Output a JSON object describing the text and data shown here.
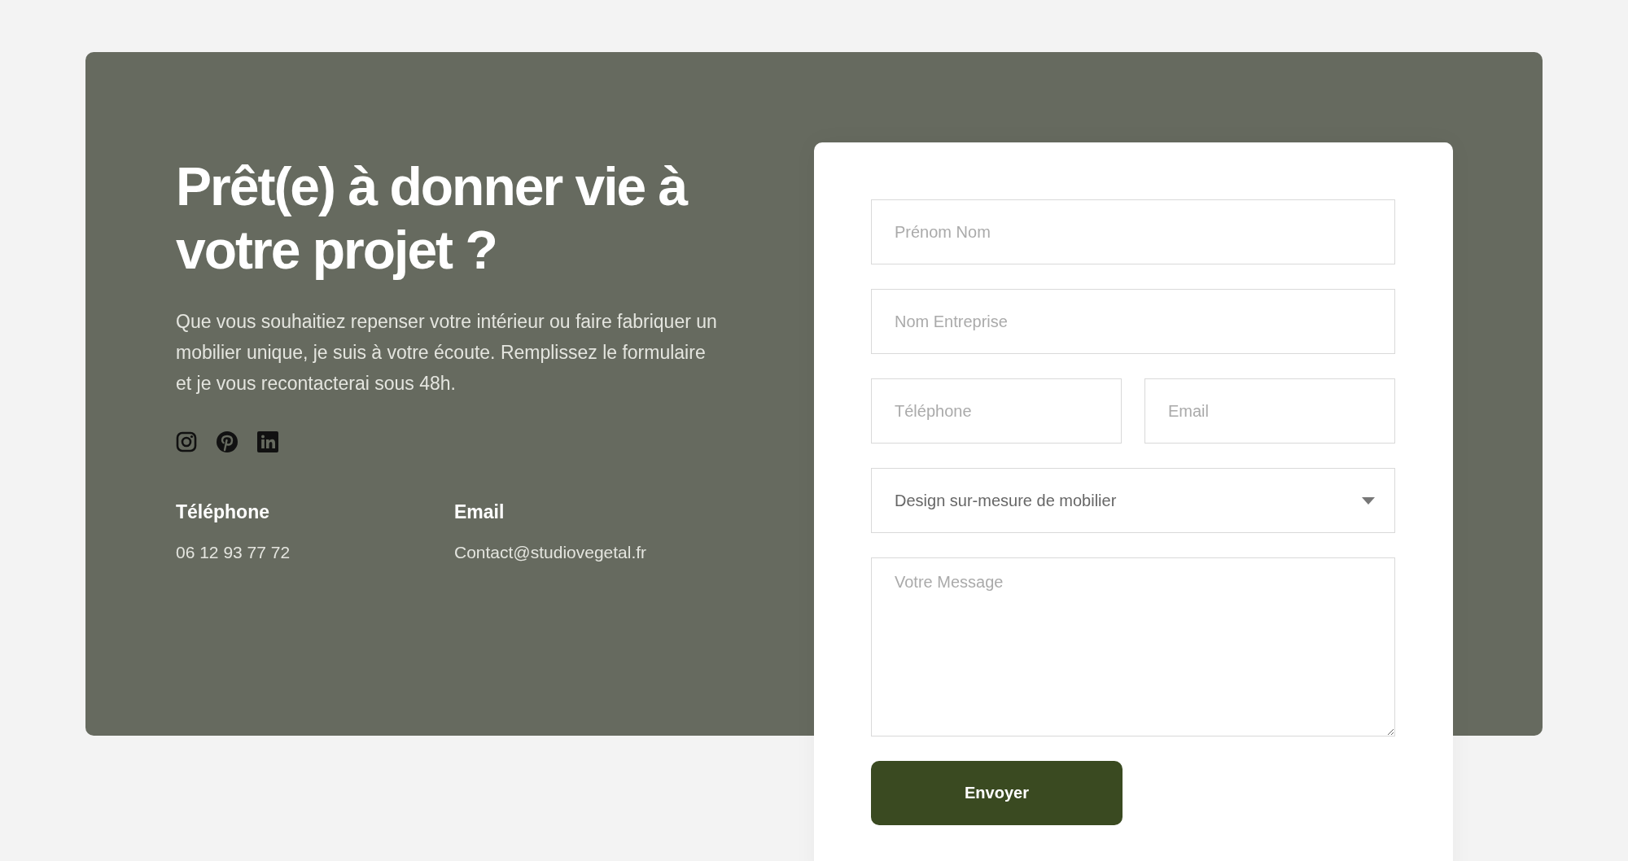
{
  "intro": {
    "heading": "Prêt(e) à donner vie à votre projet ?",
    "text": "Que vous souhaitiez repenser votre intérieur ou faire fabriquer un mobilier unique, je suis à votre écoute. Remplissez le formulaire et je vous recontacterai sous 48h.",
    "contacts": [
      {
        "label": "Téléphone",
        "value": "06 12 93 77 72"
      },
      {
        "label": "Email",
        "value": "Contact@studiovegetal.fr"
      }
    ]
  },
  "form": {
    "rows": [
      [
        {
          "kind": "text",
          "placeholder": "Prénom Nom"
        }
      ],
      [
        {
          "kind": "text",
          "placeholder": "Nom Entreprise"
        }
      ],
      [
        {
          "kind": "text",
          "placeholder": "Téléphone"
        },
        {
          "kind": "text",
          "placeholder": "Email"
        }
      ],
      [
        {
          "kind": "select",
          "value": "Design sur-mesure de mobilier"
        }
      ],
      [
        {
          "kind": "textarea",
          "placeholder": "Votre Message"
        }
      ]
    ],
    "button": "Envoyer"
  }
}
